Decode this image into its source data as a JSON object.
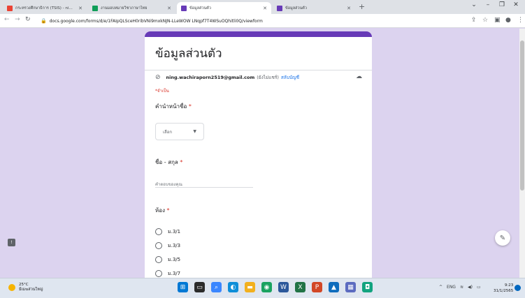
{
  "browser": {
    "tabs": [
      {
        "label": "กระทรวงศึกษาธิการ (TSIS) - ning.wachiraporn",
        "favicon": "gmail-icon",
        "active": false
      },
      {
        "label": "งานมอบหมายวิชาภาษาไทย",
        "favicon": "sheets-icon",
        "active": false
      },
      {
        "label": "ข้อมูลส่วนตัว",
        "favicon": "forms-icon",
        "active": true
      },
      {
        "label": "ข้อมูลส่วนตัว",
        "favicon": "forms-icon",
        "active": false
      }
    ],
    "url": "docs.google.com/forms/d/e/1FAIpQLSceH0ribVNi9mxkNJN-LLeWOW LNqpf7T4WSuOQhitli0Q/viewform"
  },
  "form": {
    "title": "ข้อมูลส่วนตัว",
    "account_email": "ning.wachiraporn2519@gmail.com",
    "account_share": "(ยังไม่แชร์)",
    "switch_account": "สลับบัญชี",
    "required_note": "*จำเป็น",
    "questions": [
      {
        "title": "คำนำหน้าชื่อ",
        "required_mark": "*",
        "type": "dropdown",
        "placeholder": "เลือก"
      },
      {
        "title": "ชื่อ - สกุล",
        "required_mark": "*",
        "type": "short_answer",
        "placeholder": "คำตอบของคุณ"
      },
      {
        "title": "ห้อง",
        "required_mark": "*",
        "type": "radio",
        "options": [
          "ม.3/1",
          "ม.3/3",
          "ม.3/5",
          "ม.3/7"
        ]
      }
    ]
  },
  "taskbar": {
    "weather_temp": "25°C",
    "weather_desc": "มีเมฆส่วนใหญ่",
    "tray_lang": "ENG",
    "time": "9:23",
    "date": "31/1/2565"
  },
  "colors": {
    "accent": "#673ab7",
    "background": "#dcd3ef",
    "required": "#d93025",
    "link": "#1a73e8"
  }
}
